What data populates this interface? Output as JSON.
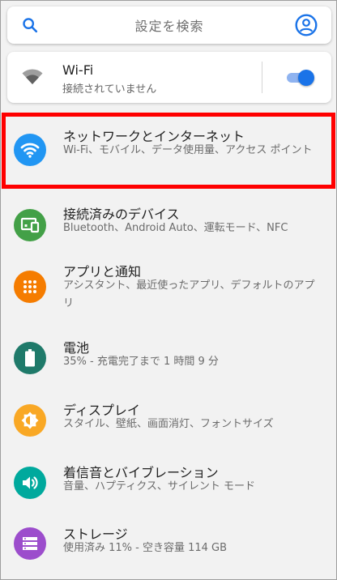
{
  "search": {
    "placeholder": "設定を検索"
  },
  "wifi": {
    "title": "Wi-Fi",
    "status": "接続されていません",
    "toggle_on": true
  },
  "colors": {
    "accent": "#1a73e8",
    "highlight": "#ff0000"
  },
  "items": [
    {
      "title": "ネットワークとインターネット",
      "summary": "Wi-Fi、モバイル、データ使用量、アクセス ポイント",
      "icon": "wifi-icon",
      "color": "#2196f3"
    },
    {
      "title": "接続済みのデバイス",
      "summary": "Bluetooth、Android Auto、運転モード、NFC",
      "icon": "devices-icon",
      "color": "#43a047"
    },
    {
      "title": "アプリと通知",
      "summary": "アシスタント、最近使ったアプリ、デフォルトのアプリ",
      "icon": "apps-icon",
      "color": "#f57c00"
    },
    {
      "title": "電池",
      "summary": "35% - 充電完了まで 1 時間 9 分",
      "icon": "battery-icon",
      "color": "#1f7a6a"
    },
    {
      "title": "ディスプレイ",
      "summary": "スタイル、壁紙、画面消灯、フォントサイズ",
      "icon": "brightness-icon",
      "color": "#f9a825"
    },
    {
      "title": "着信音とバイブレーション",
      "summary": "音量、ハプティクス、サイレント モード",
      "icon": "volume-icon",
      "color": "#00a99d"
    },
    {
      "title": "ストレージ",
      "summary": "使用済み 11% - 空き容量 114 GB",
      "icon": "storage-icon",
      "color": "#9c4dcc"
    }
  ]
}
